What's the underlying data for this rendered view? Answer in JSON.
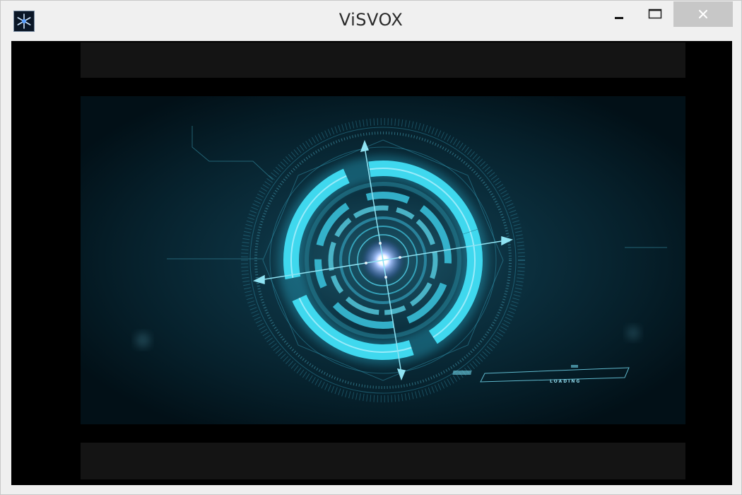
{
  "window": {
    "title": "ViSVOX",
    "controls": {
      "minimize_glyph": "—",
      "maximize_glyph": "□",
      "close_glyph": "✕"
    }
  },
  "video": {
    "overlay_status": "LOADING"
  },
  "colors": {
    "hud_cyan": "#3fd8ee",
    "hud_glow": "#2ab6d6",
    "background_dark": "#03121a",
    "letterbox": "#141414"
  },
  "icons": {
    "app": "snowflake-app-icon",
    "minimize": "minimize-icon",
    "maximize": "maximize-icon",
    "close": "close-icon"
  }
}
